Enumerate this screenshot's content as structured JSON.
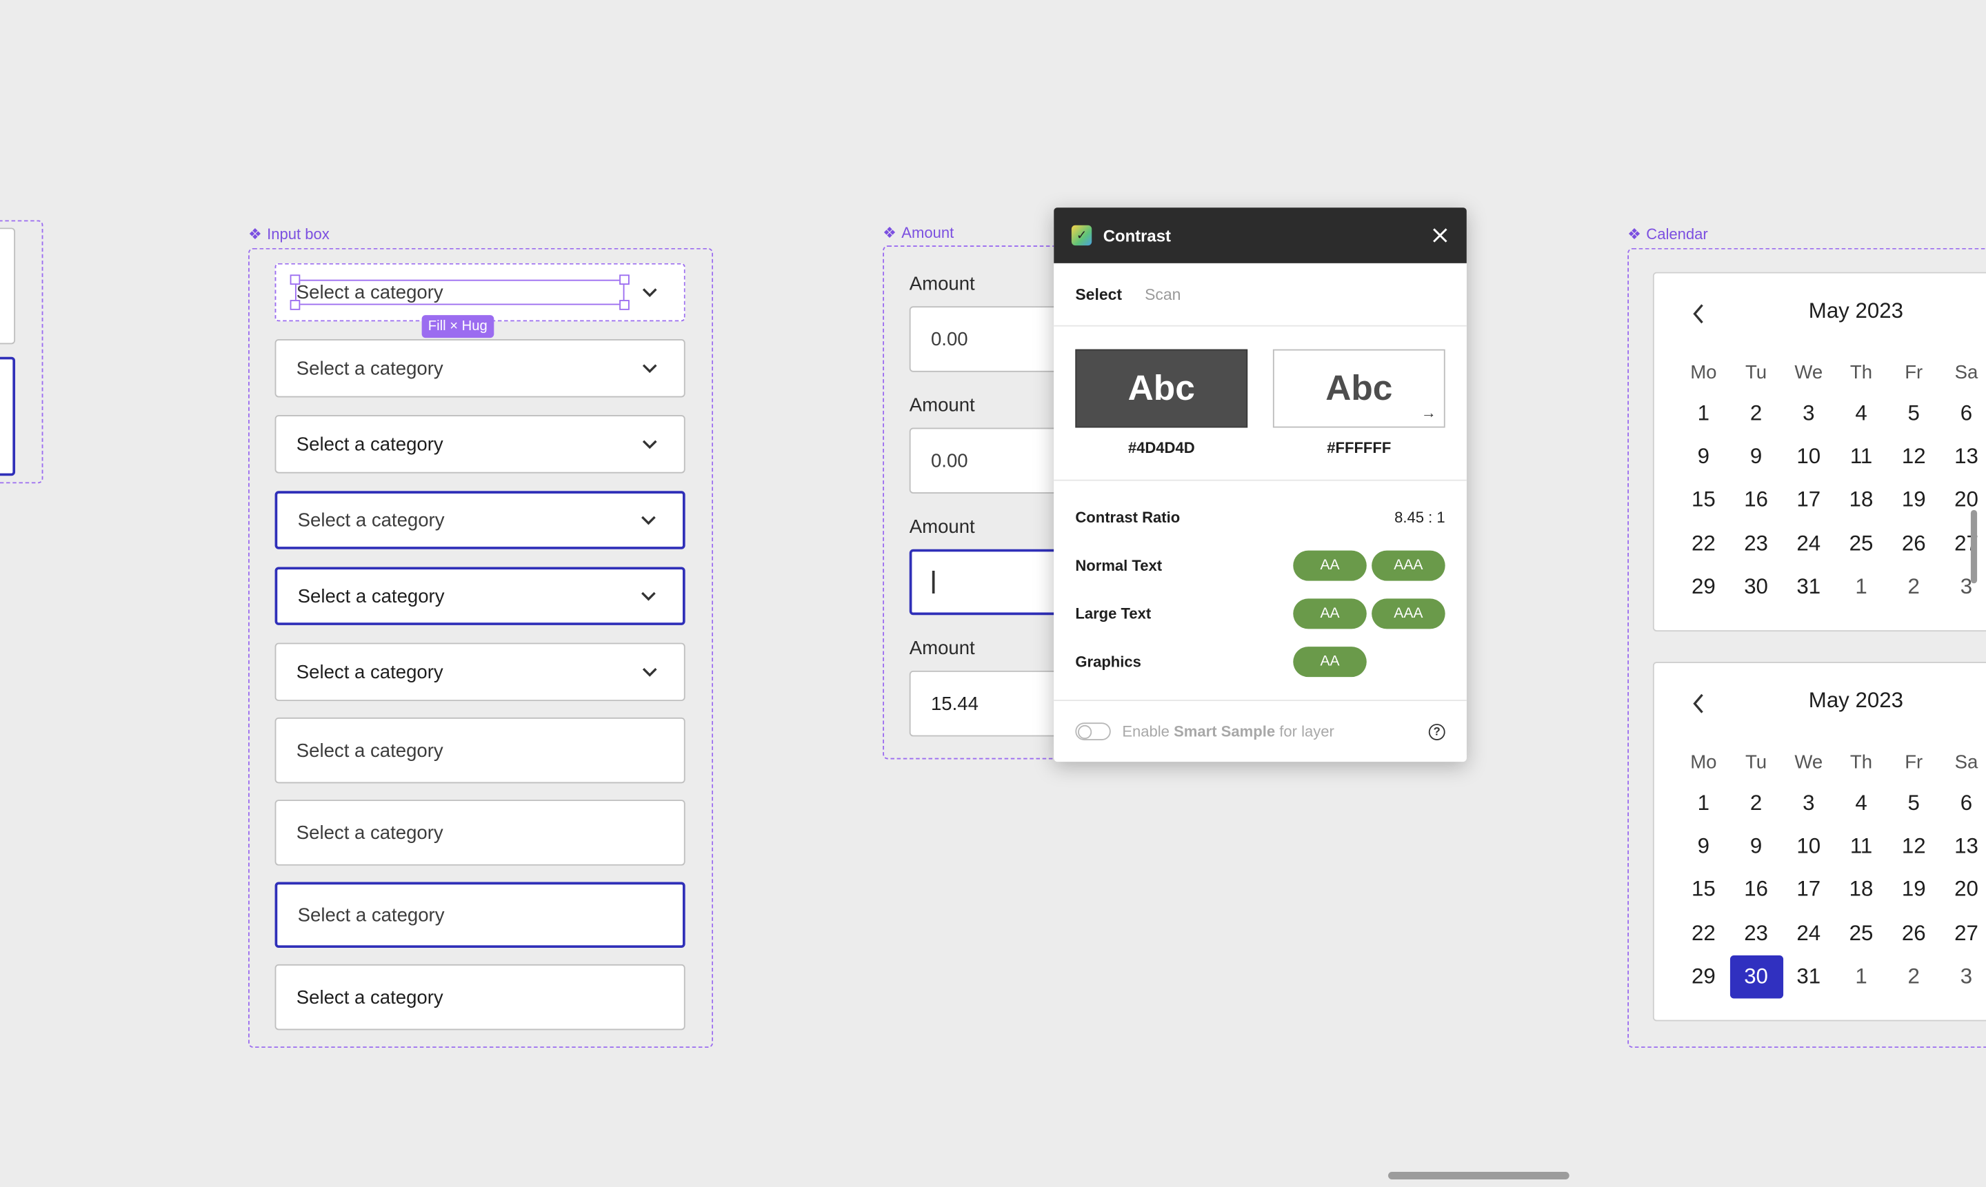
{
  "input_box_frame": {
    "label": "Input box",
    "select_placeholder": "Select a category",
    "fill_hug_label": "Fill × Hug"
  },
  "amount_frame": {
    "label": "Amount",
    "fields": [
      {
        "label": "Amount",
        "value": "0.00"
      },
      {
        "label": "Amount",
        "value": "0.00"
      },
      {
        "label": "Amount",
        "value": ""
      },
      {
        "label": "Amount",
        "value": "15.44"
      }
    ]
  },
  "contrast_panel": {
    "title": "Contrast",
    "tabs": [
      "Select",
      "Scan"
    ],
    "foreground": {
      "sample": "Abc",
      "hex": "#4D4D4D"
    },
    "background": {
      "sample": "Abc",
      "hex": "#FFFFFF"
    },
    "contrast_ratio_label": "Contrast Ratio",
    "contrast_ratio_value": "8.45 : 1",
    "rows": [
      {
        "label": "Normal Text",
        "badges": [
          "AA",
          "AAA"
        ]
      },
      {
        "label": "Large Text",
        "badges": [
          "AA",
          "AAA"
        ]
      },
      {
        "label": "Graphics",
        "badges": [
          "AA"
        ]
      }
    ],
    "footer_prefix": "Enable ",
    "footer_strong": "Smart Sample",
    "footer_suffix": " for layer",
    "help_glyph": "?"
  },
  "calendar_frame": {
    "label": "Calendar",
    "month": "May 2023",
    "weekdays": [
      "Mo",
      "Tu",
      "We",
      "Th",
      "Fr",
      "Sa"
    ],
    "weeks": [
      [
        "1",
        "2",
        "3",
        "4",
        "5",
        "6"
      ],
      [
        "9",
        "9",
        "10",
        "11",
        "12",
        "13"
      ],
      [
        "15",
        "16",
        "17",
        "18",
        "19",
        "20"
      ],
      [
        "22",
        "23",
        "24",
        "25",
        "26",
        "27"
      ],
      [
        "29",
        "30",
        "31",
        "1",
        "2",
        "3"
      ]
    ],
    "selected_day": "30"
  }
}
